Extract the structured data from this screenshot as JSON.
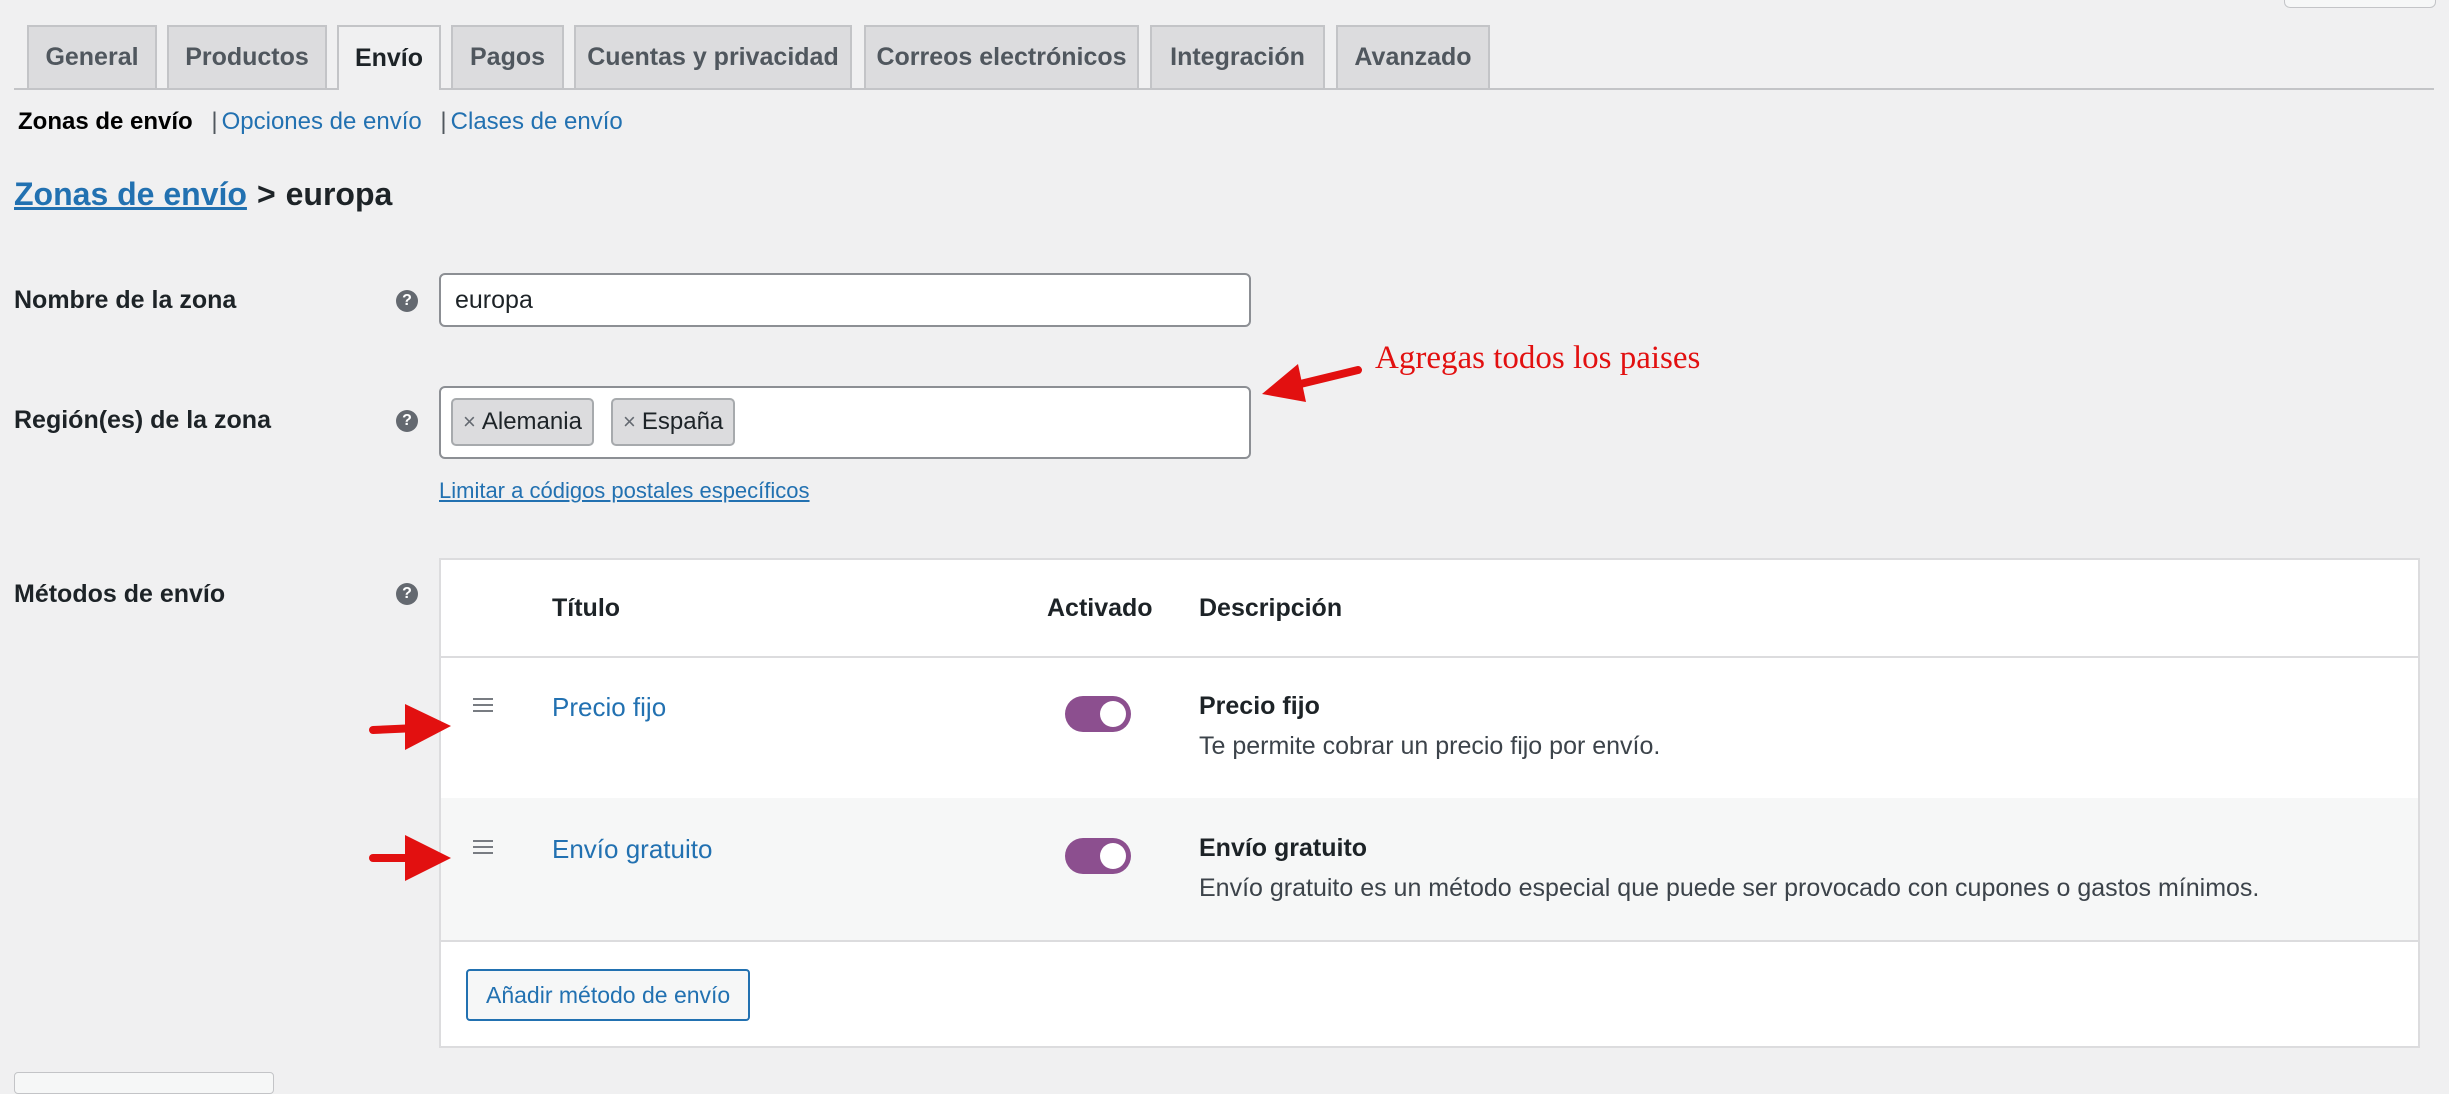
{
  "tabs": [
    {
      "label": "General",
      "active": false
    },
    {
      "label": "Productos",
      "active": false
    },
    {
      "label": "Envío",
      "active": true
    },
    {
      "label": "Pagos",
      "active": false
    },
    {
      "label": "Cuentas y privacidad",
      "active": false
    },
    {
      "label": "Correos electrónicos",
      "active": false
    },
    {
      "label": "Integración",
      "active": false
    },
    {
      "label": "Avanzado",
      "active": false
    }
  ],
  "subnav": {
    "current": "Zonas de envío",
    "separator": "|",
    "links": [
      "Opciones de envío",
      "Clases de envío"
    ]
  },
  "breadcrumb": {
    "parent": "Zonas de envío",
    "separator": ">",
    "current": "europa"
  },
  "form": {
    "zone_name_label": "Nombre de la zona",
    "zone_name_value": "europa",
    "regions_label": "Región(es) de la zona",
    "regions": [
      "Alemania",
      "España"
    ],
    "chip_remove": "×",
    "zip_link": "Limitar a códigos postales específicos",
    "methods_label": "Métodos de envío",
    "help_glyph": "?"
  },
  "annotation": {
    "text": "Agregas todos los paises",
    "color": "#e21010"
  },
  "methods_table": {
    "headers": {
      "title": "Título",
      "enabled": "Activado",
      "description": "Descripción"
    },
    "rows": [
      {
        "title": "Precio fijo",
        "enabled": true,
        "desc_title": "Precio fijo",
        "desc_text": "Te permite cobrar un precio fijo por envío."
      },
      {
        "title": "Envío gratuito",
        "enabled": true,
        "desc_title": "Envío gratuito",
        "desc_text": "Envío gratuito es un método especial que puede ser provocado con cupones o gastos mínimos."
      }
    ],
    "add_button": "Añadir método de envío"
  },
  "colors": {
    "link": "#2271b1",
    "toggle_on": "#8c4f8f",
    "background": "#f0f0f1"
  }
}
